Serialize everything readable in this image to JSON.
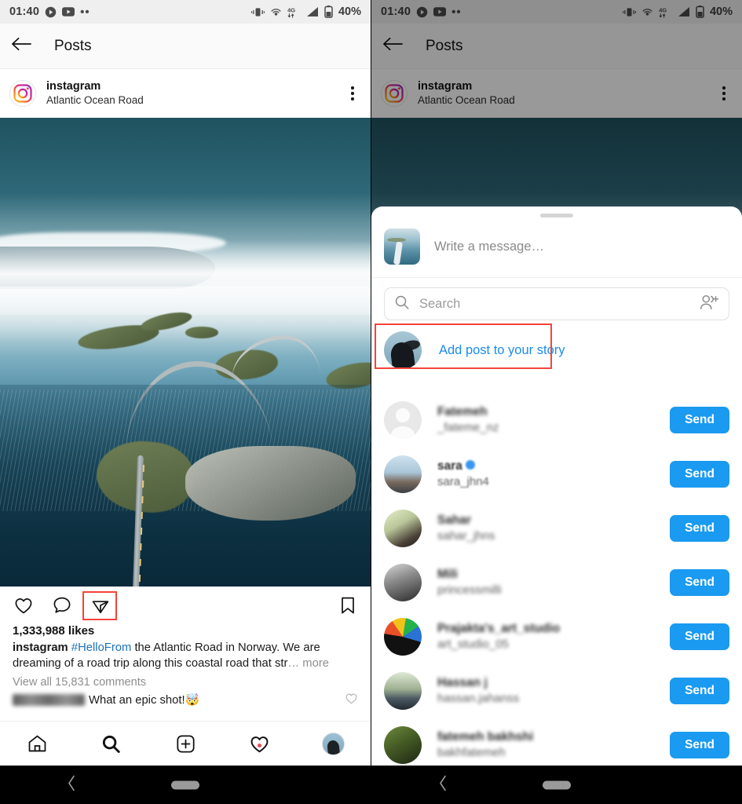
{
  "status_bar": {
    "time": "01:40",
    "dots": "••",
    "battery_percent": "40%",
    "icons": [
      "play-icon",
      "youtube-icon",
      "more-dots-icon",
      "vibrate-icon",
      "hotspot-icon",
      "network-4g-icon",
      "signal-icon",
      "battery-icon"
    ],
    "network_label": "4G"
  },
  "app_bar": {
    "back_icon": "back-arrow-icon",
    "title": "Posts"
  },
  "post": {
    "account": "instagram",
    "location": "Atlantic Ocean Road",
    "avatar_icon": "instagram-logo-icon",
    "menu_icon": "kebab-menu-icon",
    "photo_alt": "Aerial view of the Atlantic Ocean Road bridge in Norway",
    "actions": {
      "like_icon": "heart-icon",
      "comment_icon": "comment-bubble-icon",
      "share_icon": "share-paper-plane-icon",
      "save_icon": "bookmark-icon"
    },
    "likes": "1,333,988 likes",
    "caption_user": "instagram",
    "caption_hashtag": "#HelloFrom",
    "caption_text": " the Atlantic Road in Norway. We are dreaming of a road trip along this coastal road that str",
    "caption_more": "… more",
    "view_comments": "View all 15,831 comments",
    "top_comment_text": "What an epic shot!🤯",
    "top_comment_like_icon": "heart-outline-icon"
  },
  "tab_bar": {
    "items": [
      {
        "name": "home",
        "icon": "home-icon"
      },
      {
        "name": "search",
        "icon": "search-icon"
      },
      {
        "name": "create",
        "icon": "plus-square-icon"
      },
      {
        "name": "activity",
        "icon": "heart-icon",
        "badge": true
      },
      {
        "name": "profile",
        "icon": "profile-avatar-icon"
      }
    ]
  },
  "share_sheet": {
    "grabber_icon": "drag-handle-icon",
    "message_placeholder": "Write a message…",
    "post_thumbnail_icon": "post-thumbnail-icon",
    "search_placeholder": "Search",
    "search_icon": "search-icon",
    "add_people_icon": "add-people-icon",
    "story_label": "Add post to your story",
    "story_avatar_icon": "story-avatar-icon",
    "send_label": "Send",
    "contacts": [
      {
        "name": "Fatemeh",
        "username": "_fatemе_nz",
        "avatar": "av-blank",
        "verified": false
      },
      {
        "name": "sara",
        "username": "sara_jhn4",
        "avatar": "av-sara",
        "verified": true
      },
      {
        "name": "Sahar",
        "username": "sahar_jhns",
        "avatar": "av-sahar",
        "verified": false
      },
      {
        "name": "Mili",
        "username": "princessmilli",
        "avatar": "av-mili",
        "verified": false
      },
      {
        "name": "Prajakta's_art_studio",
        "username": "art_studio_05",
        "avatar": "av-art",
        "verified": false
      },
      {
        "name": "Hassan j",
        "username": "hassan.jahanss",
        "avatar": "av-hassan",
        "verified": false
      },
      {
        "name": "fatemeh bakhshi",
        "username": "bakhfatemeh",
        "avatar": "av-fatemeh",
        "verified": false
      }
    ]
  },
  "android_nav": {
    "back_icon": "nav-back-icon",
    "home_icon": "nav-home-pill-icon"
  },
  "colors": {
    "accent_blue": "#1a9af0",
    "link_blue": "#1d72b8",
    "highlight_red": "#f4443a",
    "badge_red": "#ed4956",
    "status_bar_bg": "#efeff0"
  }
}
